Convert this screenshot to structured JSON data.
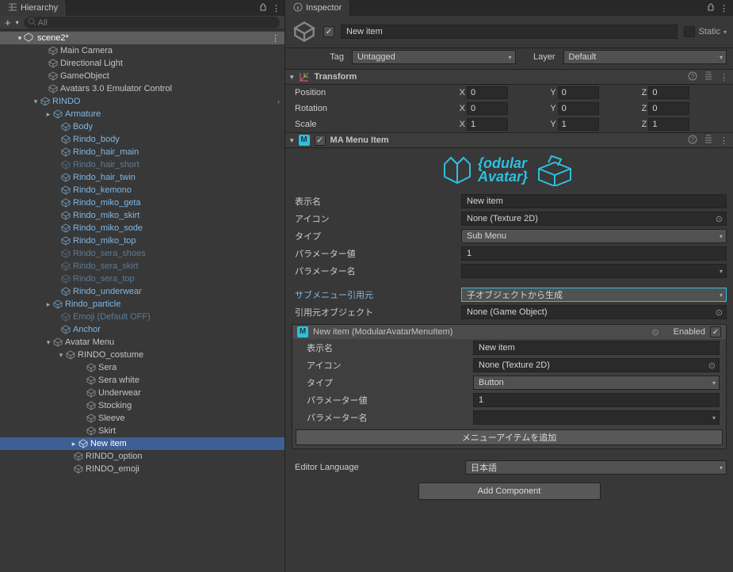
{
  "hierarchy": {
    "tab_title": "Hierarchy",
    "search_placeholder": "All",
    "scene": "scene2*",
    "nodes": {
      "main_camera": "Main Camera",
      "dir_light": "Directional Light",
      "gameobject": "GameObject",
      "avatars_emu": "Avatars 3.0 Emulator Control",
      "rindo": "RINDO",
      "armature": "Armature",
      "body": "Body",
      "rindo_body": "Rindo_body",
      "rindo_hair_main": "Rindo_hair_main",
      "rindo_hair_short": "Rindo_hair_short",
      "rindo_hair_twin": "Rindo_hair_twin",
      "rindo_kemono": "Rindo_kemono",
      "rindo_miko_geta": "Rindo_miko_geta",
      "rindo_miko_skirt": "Rindo_miko_skirt",
      "rindo_miko_sode": "Rindo_miko_sode",
      "rindo_miko_top": "Rindo_miko_top",
      "rindo_sera_shoes": "Rindo_sera_shoes",
      "rindo_sera_skirt": "Rindo_sera_skirt",
      "rindo_sera_top": "Rindo_sera_top",
      "rindo_underwear": "Rindo_underwear",
      "rindo_particle": "Rindo_particle",
      "emoji_off": "Emoji (Default OFF)",
      "anchor": "Anchor",
      "avatar_menu": "Avatar Menu",
      "rindo_costume": "RINDO_costume",
      "sera": "Sera",
      "sera_white": "Sera white",
      "underwear": "Underwear",
      "stocking": "Stocking",
      "sleeve": "Sleeve",
      "skirt": "Skirt",
      "new_item": "New item",
      "rindo_option": "RINDO_option",
      "rindo_emoji": "RINDO_emoji"
    }
  },
  "inspector": {
    "tab_title": "Inspector",
    "obj_name": "New item",
    "static_label": "Static",
    "tag_label": "Tag",
    "tag_value": "Untagged",
    "layer_label": "Layer",
    "layer_value": "Default",
    "transform": {
      "title": "Transform",
      "pos_label": "Position",
      "rot_label": "Rotation",
      "scale_label": "Scale",
      "pos": {
        "x": "0",
        "y": "0",
        "z": "0"
      },
      "rot": {
        "x": "0",
        "y": "0",
        "z": "0"
      },
      "scale": {
        "x": "1",
        "y": "1",
        "z": "1"
      }
    },
    "ma": {
      "title": "MA Menu Item",
      "logo_line1": "odular",
      "logo_line2": "Avatar",
      "display_name_label": "表示名",
      "display_name": "New item",
      "icon_label": "アイコン",
      "icon_value": "None (Texture 2D)",
      "type_label": "タイプ",
      "type_value": "Sub Menu",
      "param_val_label": "パラメーター値",
      "param_val": "1",
      "param_name_label": "パラメーター名",
      "param_name": "",
      "submenu_src_label": "サブメニュー引用元",
      "submenu_src": "子オブジェクトから生成",
      "src_obj_label": "引用元オブジェクト",
      "src_obj": "None (Game Object)",
      "child": {
        "header": "New item (ModularAvatarMenuItem)",
        "enabled_label": "Enabled",
        "display_name_label": "表示名",
        "display_name": "New item",
        "icon_label": "アイコン",
        "icon_value": "None (Texture 2D)",
        "type_label": "タイプ",
        "type_value": "Button",
        "param_val_label": "パラメーター値",
        "param_val": "1",
        "param_name_label": "パラメーター名",
        "param_name": ""
      },
      "add_item_label": "メニューアイテムを追加"
    },
    "lang_label": "Editor Language",
    "lang_value": "日本語",
    "add_component": "Add Component"
  }
}
